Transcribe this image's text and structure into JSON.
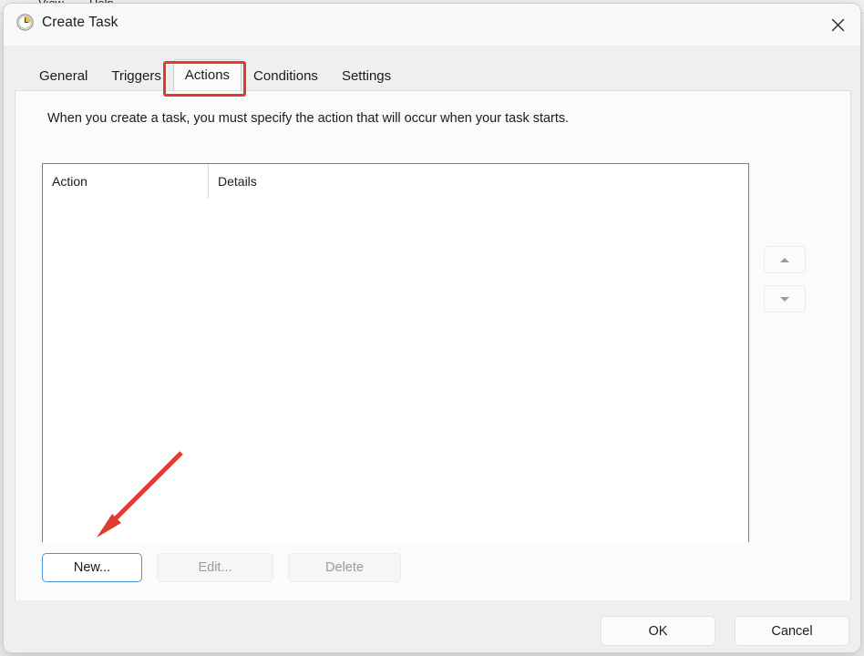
{
  "background_window": {
    "menu_items": [
      "View",
      "Help"
    ]
  },
  "dialog": {
    "title": "Create Task",
    "title_icon": "clock-icon",
    "close_icon": "close-icon",
    "tabs": [
      {
        "label": "General",
        "selected": false
      },
      {
        "label": "Triggers",
        "selected": false
      },
      {
        "label": "Actions",
        "selected": true
      },
      {
        "label": "Conditions",
        "selected": false
      },
      {
        "label": "Settings",
        "selected": false
      }
    ],
    "description": "When you create a task, you must specify the action that will occur when your task starts.",
    "list": {
      "columns": [
        "Action",
        "Details"
      ],
      "rows": []
    },
    "reorder": {
      "move_up_icon": "triangle-up-icon",
      "move_down_icon": "triangle-down-icon"
    },
    "action_buttons": [
      {
        "label": "New...",
        "state": "focused"
      },
      {
        "label": "Edit...",
        "state": "disabled"
      },
      {
        "label": "Delete",
        "state": "disabled"
      }
    ],
    "footer_buttons": [
      {
        "label": "OK"
      },
      {
        "label": "Cancel"
      }
    ]
  },
  "annotations": {
    "highlight_color": "#e03b2f",
    "arrow_color": "#e03b2f",
    "highlight_target": "Actions",
    "arrow_target": "New..."
  },
  "colors": {
    "accent_focus": "#4b95d6",
    "dialog_bg": "#f0eff0",
    "panel_bg": "#fbfbfb",
    "titlebar_bg": "#f9f9f9",
    "list_bg": "#ffffff",
    "list_border": "#7d7d7d",
    "text": "#1b1b1b",
    "text_disabled": "#9a9a9a"
  }
}
